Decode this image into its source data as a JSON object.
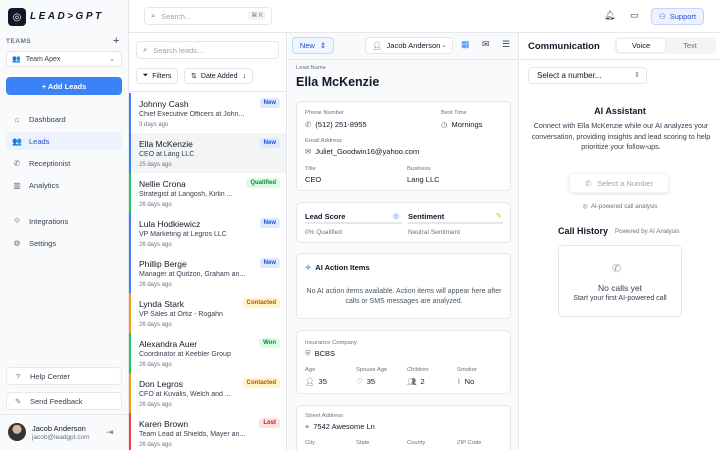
{
  "brand": {
    "logo_text": "LEAD>GPT",
    "logo_glyph": "◎"
  },
  "sidebar": {
    "teams_label": "TEAMS",
    "add_team": "+",
    "team": "Team Apex",
    "add_leads": "+  Add Leads",
    "nav": [
      {
        "label": "Dashboard",
        "icon": "⌂"
      },
      {
        "label": "Leads",
        "icon": "👥"
      },
      {
        "label": "Receptionist",
        "icon": "✆"
      },
      {
        "label": "Analytics",
        "icon": "▥"
      },
      {
        "label": "Integrations",
        "icon": "⟐"
      },
      {
        "label": "Settings",
        "icon": "⚙"
      }
    ],
    "help": "Help Center",
    "feedback": "Send Feedback",
    "user": {
      "name": "Jacob Anderson",
      "email": "jacob@leadgpt.com"
    }
  },
  "topbar": {
    "search_placeholder": "Search...",
    "shortcut": "⌘ K",
    "support": "Support"
  },
  "leads": {
    "search_placeholder": "Search leads...",
    "filters": "Filters",
    "sort": "Date Added",
    "items": [
      {
        "name": "Johnny Cash",
        "title": "Chief Executive Officers at John...",
        "time": "3 days ago",
        "status": "New"
      },
      {
        "name": "Ella McKenzie",
        "title": "CEO at Lang LLC",
        "time": "25 days ago",
        "status": "New"
      },
      {
        "name": "Nellie Crona",
        "title": "Strategist at Langosh, Kirlin ...",
        "time": "26 days ago",
        "status": "Qualified"
      },
      {
        "name": "Lula Hodkiewicz",
        "title": "VP Marketing at Legros LLC",
        "time": "26 days ago",
        "status": "New"
      },
      {
        "name": "Phillip Berge",
        "title": "Manager at Quitzon, Graham an...",
        "time": "26 days ago",
        "status": "New"
      },
      {
        "name": "Lynda Stark",
        "title": "VP Sales at Ortiz - Rogahn",
        "time": "26 days ago",
        "status": "Contacted"
      },
      {
        "name": "Alexandra Auer",
        "title": "Coordinator at Keebler Group",
        "time": "26 days ago",
        "status": "Won"
      },
      {
        "name": "Don Legros",
        "title": "CFO at Kuvalis, Welch and ...",
        "time": "26 days ago",
        "status": "Contacted"
      },
      {
        "name": "Karen Brown",
        "title": "Team Lead at Shields, Mayer an...",
        "time": "26 days ago",
        "status": "Lost"
      }
    ]
  },
  "detail": {
    "status": "New",
    "assignee": "Jacob Anderson",
    "lead_name_label": "Lead Name",
    "lead_name": "Ella McKenzie",
    "phone_label": "Phone Number",
    "phone": "(512) 251-8955",
    "best_time_label": "Best Time",
    "best_time": "Mornings",
    "email_label": "Email Address",
    "email": "Juliet_Goodwin16@yahoo.com",
    "title_label": "Title",
    "title": "CEO",
    "business_label": "Business",
    "business": "Lang LLC",
    "lead_score_label": "Lead Score",
    "lead_score_value": "0% Qualified",
    "sentiment_label": "Sentiment",
    "sentiment_value": "Neutral Sentiment",
    "ai_actions_title": "AI Action Items",
    "ai_actions_empty": "No AI action items available. Action items will appear here after calls or SMS messages are analyzed.",
    "insurance_label": "Insurance Company",
    "insurance": "BCBS",
    "age_label": "Age",
    "age": "35",
    "spouse_age_label": "Spouse Age",
    "spouse_age": "35",
    "children_label": "Children",
    "children": "2",
    "smoker_label": "Smoker",
    "smoker": "No",
    "street_label": "Street Address",
    "street": "7542 Awesome Ln",
    "city_label": "City",
    "state_label": "State",
    "county_label": "County",
    "zip_label": "ZIP Code"
  },
  "communication": {
    "title": "Communication",
    "tabs": [
      "Voice",
      "Text"
    ],
    "number_select": "Select a number...",
    "ai_title": "AI Assistant",
    "ai_desc": "Connect with Ella McKenzie while our AI analyzes your conversation, providing insights and lead scoring to help prioritize your follow-ups.",
    "select_number_btn": "Select a Number",
    "ai_powered": "AI-powered call analysis",
    "call_history_title": "Call History",
    "call_history_sub": "Powered by AI Analysis",
    "no_calls": "No calls yet",
    "no_calls_sub": "Start your first AI-powered call"
  },
  "colors": {
    "accent": "#3b82f6",
    "new": "#1d4ed8",
    "qualified": "#15803d",
    "contacted": "#b45309",
    "won": "#15803d",
    "lost": "#b91c1c"
  }
}
